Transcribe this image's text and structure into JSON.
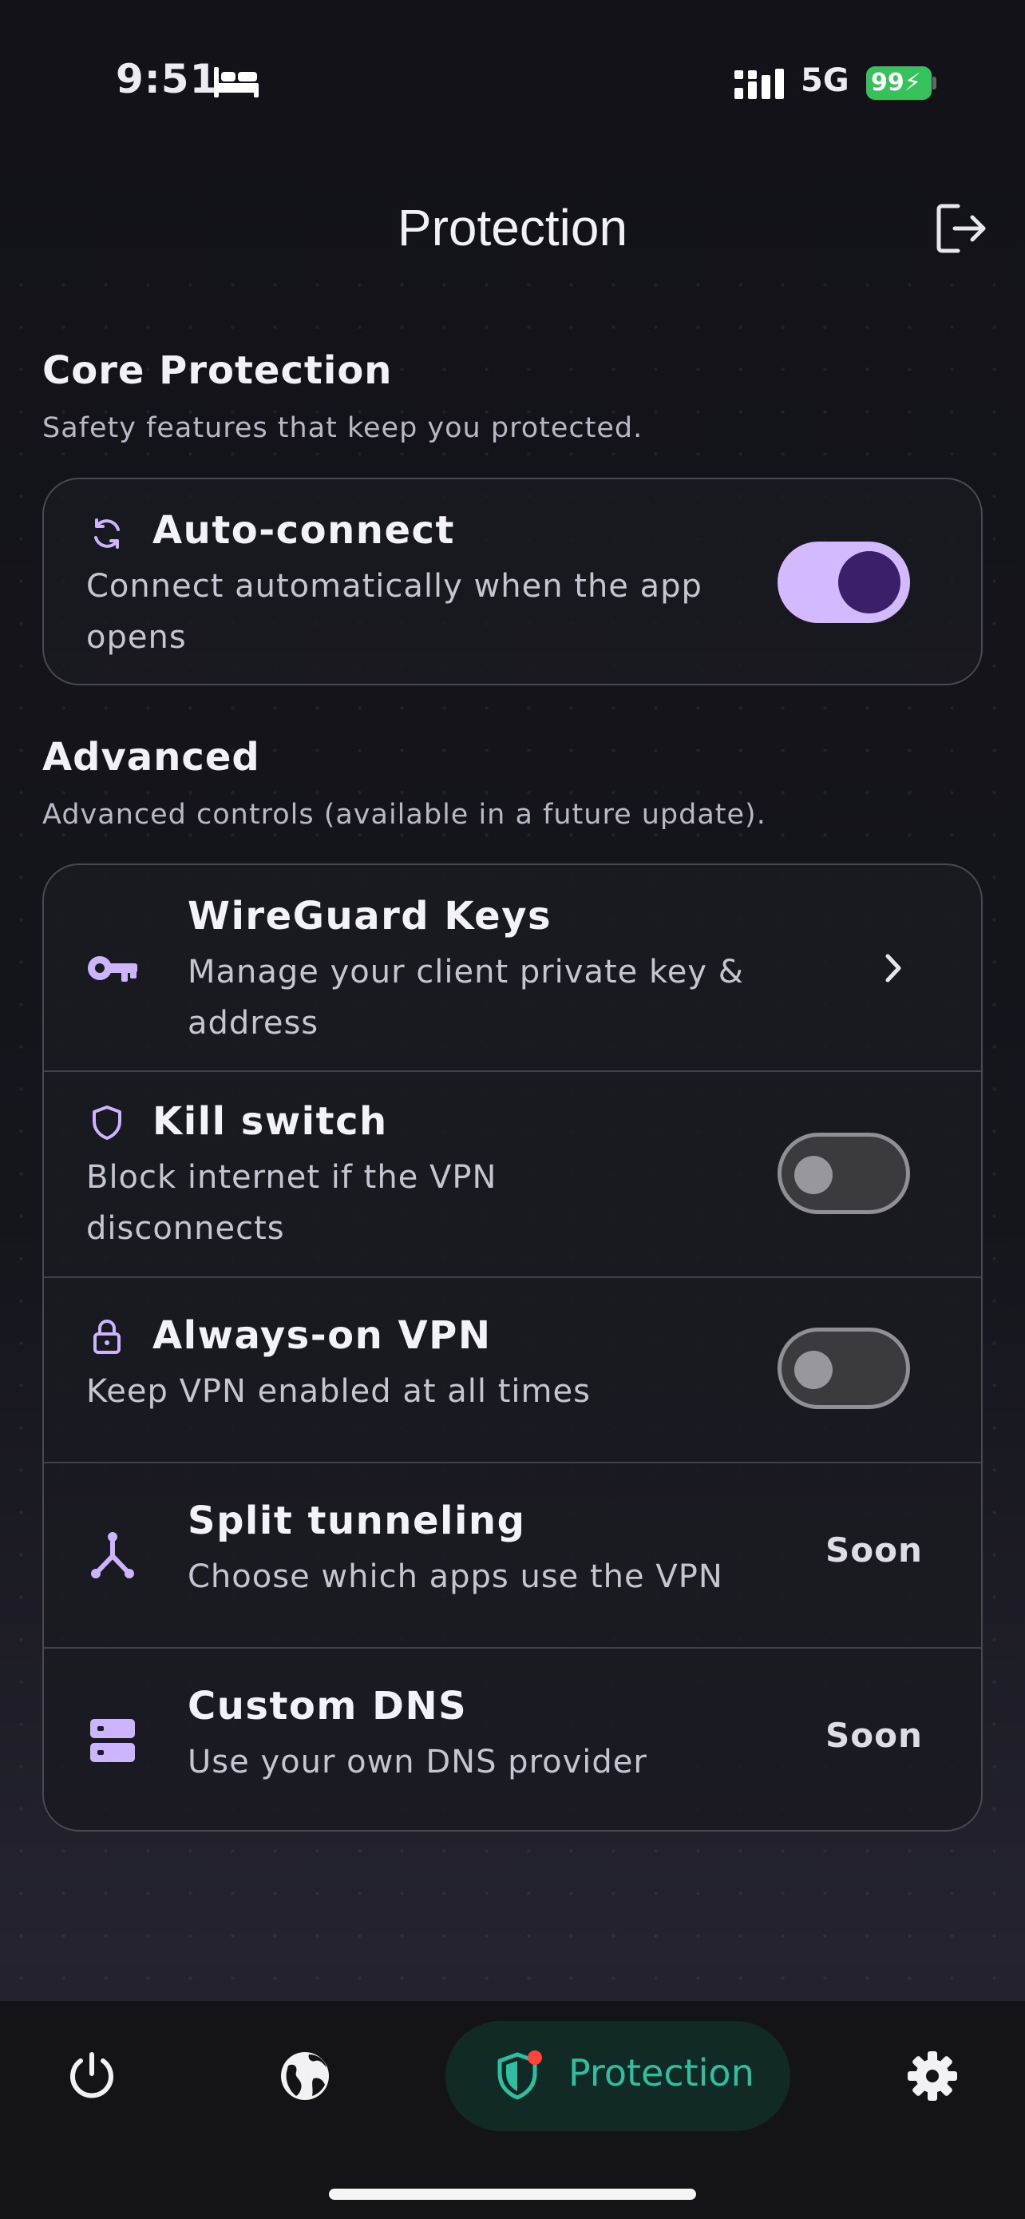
{
  "status_bar": {
    "time": "9:51",
    "network": "5G",
    "battery": "99"
  },
  "header": {
    "title": "Protection",
    "logout_icon": "logout-icon"
  },
  "core": {
    "title": "Core Protection",
    "subtitle": "Safety features that keep you protected.",
    "auto_connect": {
      "title": "Auto-connect",
      "desc_line1": "Connect automatically when the app",
      "desc_line2": "opens",
      "enabled": true
    }
  },
  "advanced": {
    "title": "Advanced",
    "subtitle": "Advanced controls (available in a future update).",
    "wireguard": {
      "title": "WireGuard Keys",
      "desc_line1": "Manage your client private key &",
      "desc_line2": "address"
    },
    "kill_switch": {
      "title": "Kill switch",
      "desc_line1": "Block internet if the VPN",
      "desc_line2": "disconnects",
      "enabled": false
    },
    "always_on": {
      "title": "Always-on VPN",
      "desc": "Keep VPN enabled at all times",
      "enabled": false
    },
    "split": {
      "title": "Split tunneling",
      "desc": "Choose which apps use the VPN",
      "badge": "Soon"
    },
    "dns": {
      "title": "Custom DNS",
      "desc": "Use your own DNS provider",
      "badge": "Soon"
    }
  },
  "nav": {
    "protection_label": "Protection",
    "active": "protection"
  },
  "colors": {
    "accent": "#d3b9ff",
    "accent_dark": "#3b1f6b",
    "active_tab": "#2fbfa0",
    "badge_dot": "#ff453a"
  }
}
